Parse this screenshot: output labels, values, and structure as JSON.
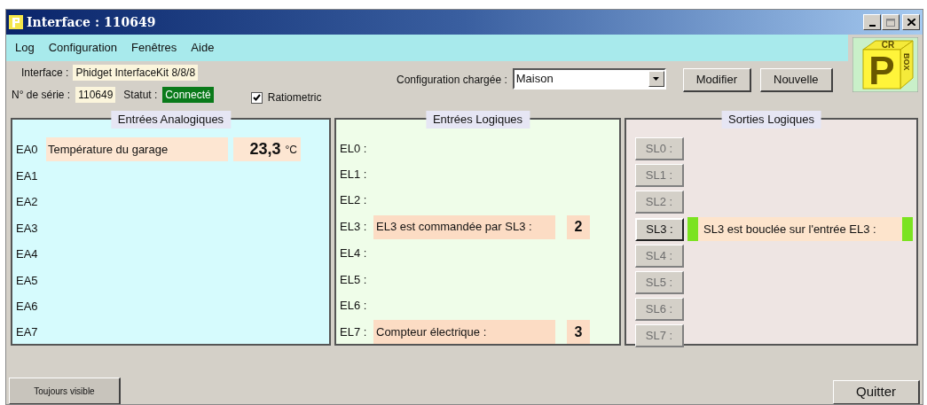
{
  "window": {
    "title": "Interface : 110649"
  },
  "menu": [
    "Log",
    "Configuration",
    "Fenêtres",
    "Aide"
  ],
  "logo": {
    "front": "P",
    "top": "CR",
    "side": "BOX"
  },
  "info": {
    "interface_label": "Interface :",
    "interface_value": "Phidget InterfaceKit 8/8/8",
    "serial_label": "N° de série :",
    "serial_value": "110649",
    "status_label": "Statut :",
    "status_value": "Connecté",
    "connected": true,
    "ratiometric": {
      "label": "Ratiometric",
      "checked": true
    }
  },
  "configuration": {
    "label": "Configuration chargée :",
    "value": "Maison",
    "buttons": [
      "Modifier",
      "Nouvelle"
    ]
  },
  "analog_inputs": {
    "title": "Entrées Analogiques",
    "rows": [
      {
        "channel": "EA0",
        "label": "Température du garage",
        "value": "23,3",
        "unit": "°C"
      },
      {
        "channel": "EA1"
      },
      {
        "channel": "EA2"
      },
      {
        "channel": "EA3"
      },
      {
        "channel": "EA4"
      },
      {
        "channel": "EA5"
      },
      {
        "channel": "EA6"
      },
      {
        "channel": "EA7"
      }
    ]
  },
  "logic_inputs": {
    "title": "Entrées Logiques",
    "rows": [
      {
        "channel": "EL0 :"
      },
      {
        "channel": "EL1 :"
      },
      {
        "channel": "EL2 :"
      },
      {
        "channel": "EL3 :",
        "label": "EL3 est commandée par SL3 :",
        "count": "2"
      },
      {
        "channel": "EL4 :"
      },
      {
        "channel": "EL5 :"
      },
      {
        "channel": "EL6 :"
      },
      {
        "channel": "EL7 :",
        "label": "Compteur électrique :",
        "count": "3"
      }
    ]
  },
  "logic_outputs": {
    "title": "Sorties Logiques",
    "rows": [
      {
        "button": "SL0 :",
        "disabled": true
      },
      {
        "button": "SL1 :",
        "disabled": true
      },
      {
        "button": "SL2 :",
        "disabled": true
      },
      {
        "button": "SL3 :",
        "disabled": false,
        "label": "SL3 est bouclée sur l'entrée EL3 :",
        "output_on": true,
        "input_on": true
      },
      {
        "button": "SL4 :",
        "disabled": true
      },
      {
        "button": "SL5 :",
        "disabled": true
      },
      {
        "button": "SL6 :",
        "disabled": true
      },
      {
        "button": "SL7 :",
        "disabled": true
      }
    ]
  },
  "footer": {
    "buttons": [
      "Toujours visible",
      "Quitter"
    ]
  }
}
